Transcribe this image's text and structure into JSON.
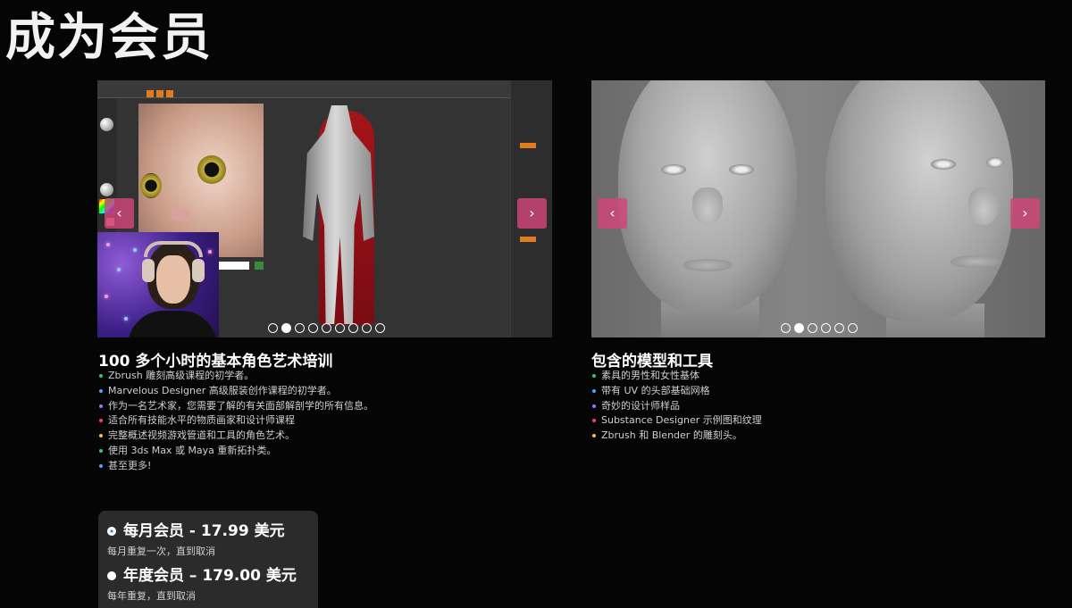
{
  "page": {
    "title": "成为会员"
  },
  "carousel_left": {
    "prev_icon": "‹",
    "next_icon": "›",
    "dot_count": 9,
    "active_dot": 1
  },
  "carousel_right": {
    "prev_icon": "‹",
    "next_icon": "›",
    "dot_count": 6,
    "active_dot": 1
  },
  "sections": [
    {
      "title": "100 多个小时的基本角色艺术培训",
      "items": [
        {
          "text": "Zbrush 雕刻高级课程的初学者。",
          "color": "#2ecc71"
        },
        {
          "text": "Marvelous Designer 高级服装创作课程的初学者。",
          "color": "#4aa3ff"
        },
        {
          "text": "作为一名艺术家，您需要了解的有关面部解剖学的所有信息。",
          "color": "#a66bff"
        },
        {
          "text": "适合所有技能水平的物质画家和设计师课程",
          "color": "#ff3b5c"
        },
        {
          "text": "完整概述视频游戏管道和工具的角色艺术。",
          "color": "#ffb347"
        },
        {
          "text": "使用 3ds Max 或 Maya 重新拓扑类。",
          "color": "#2ecc71"
        },
        {
          "text": "甚至更多!",
          "color": "#4aa3ff"
        }
      ]
    },
    {
      "title": "包含的模型和工具",
      "items": [
        {
          "text": "素具的男性和女性基体",
          "color": "#2ecc71"
        },
        {
          "text": "带有 UV 的头部基础网格",
          "color": "#4aa3ff"
        },
        {
          "text": "奇妙的设计师样品",
          "color": "#a66bff"
        },
        {
          "text": "Substance Designer 示例图和纹理",
          "color": "#ff3b5c"
        },
        {
          "text": "Zbrush 和 Blender 的雕刻头。",
          "color": "#ffb347"
        }
      ]
    }
  ],
  "plans": [
    {
      "name": "每月会员 -   17.99 美元",
      "note": "每月重复一次，直到取消",
      "selected": true
    },
    {
      "name": "年度会员 –  179.00 美元",
      "note": "每年重复，直到取消",
      "selected": false
    }
  ]
}
